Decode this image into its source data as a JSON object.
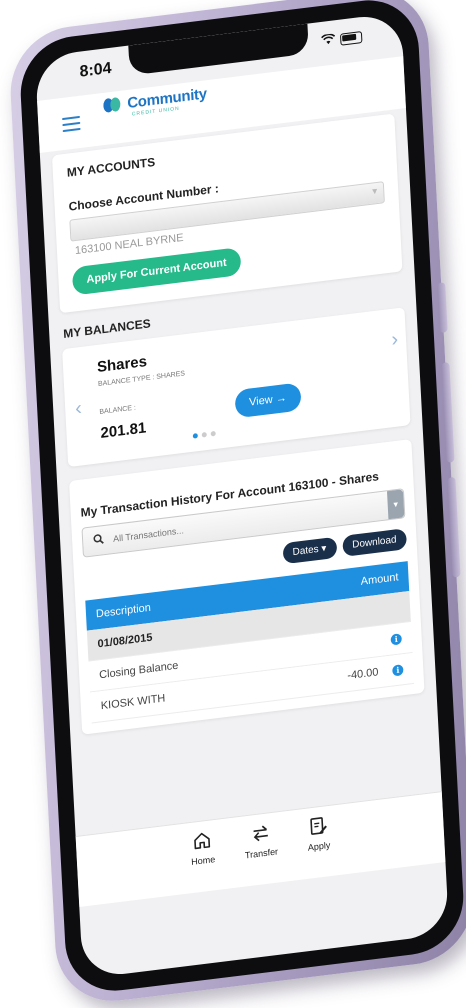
{
  "status_bar": {
    "time": "8:04"
  },
  "header": {
    "logo_text": "Community",
    "logo_subtitle": "CREDIT UNION"
  },
  "accounts": {
    "title": "MY ACCOUNTS",
    "choose_label": "Choose Account Number :",
    "selected_account": "163100 NEAL BYRNE",
    "apply_button": "Apply For Current Account"
  },
  "balances": {
    "title": "MY BALANCES",
    "card": {
      "name": "Shares",
      "type_label": "BALANCE TYPE : SHARES",
      "balance_label": "BALANCE :",
      "balance_value": "201.81",
      "view_button": "View →"
    }
  },
  "history": {
    "title": "My Transaction History For Account 163100 - Shares",
    "search_placeholder": "All Transactions...",
    "dates_button": "Dates ▾",
    "download_button": "Download",
    "columns": {
      "description": "Description",
      "amount": "Amount"
    },
    "rows": [
      {
        "description": "01/08/2015",
        "amount": ""
      },
      {
        "description": "Closing Balance",
        "amount": ""
      },
      {
        "description": "KIOSK WITH",
        "amount": "-40.00"
      }
    ]
  },
  "tab_bar": {
    "home": "Home",
    "transfer": "Transfer",
    "apply": "Apply"
  },
  "colors": {
    "accent_blue": "#1f8fe0",
    "accent_green": "#26b98a",
    "navy": "#1a2f4a",
    "phone_frame": "#bfb4d4"
  }
}
